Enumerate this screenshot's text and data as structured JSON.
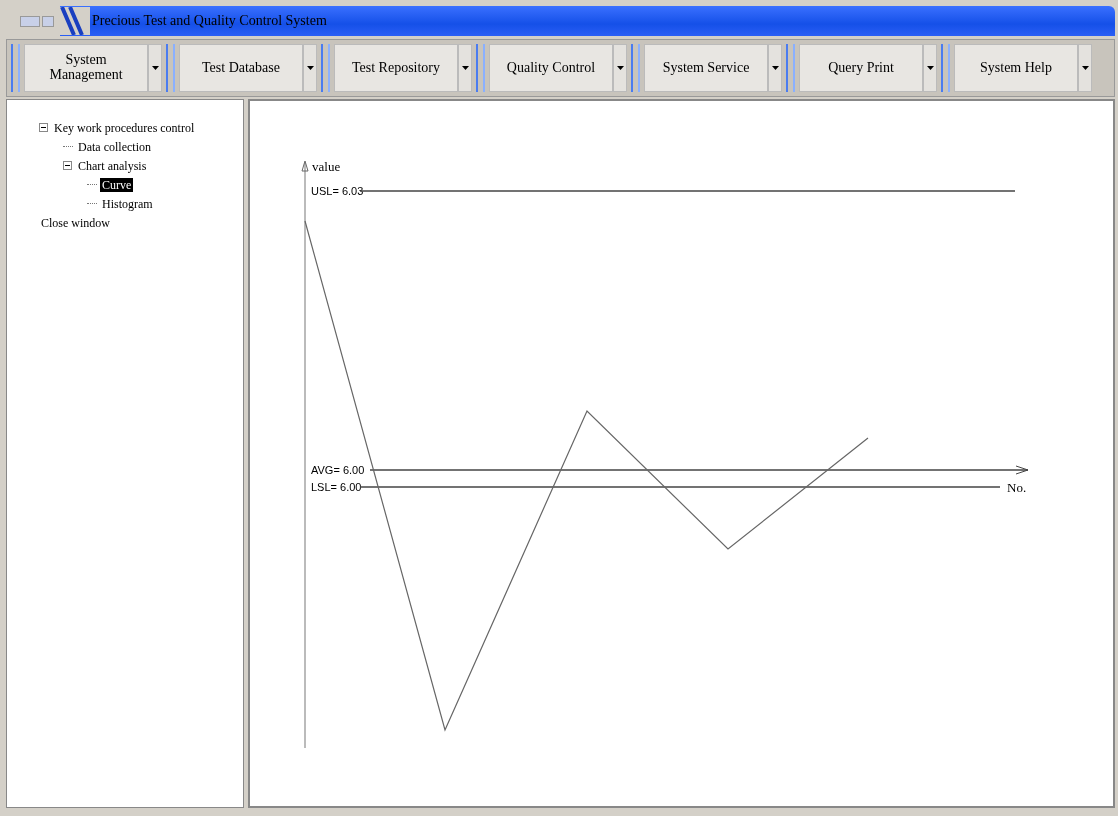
{
  "window": {
    "title": "Precious Test and Quality Control System"
  },
  "menu": [
    {
      "label": "System Management"
    },
    {
      "label": "Test Database"
    },
    {
      "label": "Test Repository"
    },
    {
      "label": "Quality Control"
    },
    {
      "label": "System Service"
    },
    {
      "label": "Query Print"
    },
    {
      "label": "System Help"
    }
  ],
  "tree": [
    {
      "label": "Key work procedures control",
      "expanded": true,
      "selected": false,
      "children": [
        {
          "label": "Data collection",
          "selected": false
        },
        {
          "label": "Chart analysis",
          "expanded": true,
          "selected": false,
          "children": [
            {
              "label": "Curve",
              "selected": true
            },
            {
              "label": "Histogram",
              "selected": false
            }
          ]
        }
      ]
    },
    {
      "label": "Close window",
      "selected": false
    }
  ],
  "chart": {
    "y_axis_label": "value",
    "x_axis_label": "No.",
    "reference_lines": [
      {
        "kind": "upper",
        "label": "USL= 6.03"
      },
      {
        "kind": "average",
        "label": "AVG= 6.00"
      },
      {
        "kind": "lower",
        "label": "LSL= 6.00"
      }
    ]
  }
}
